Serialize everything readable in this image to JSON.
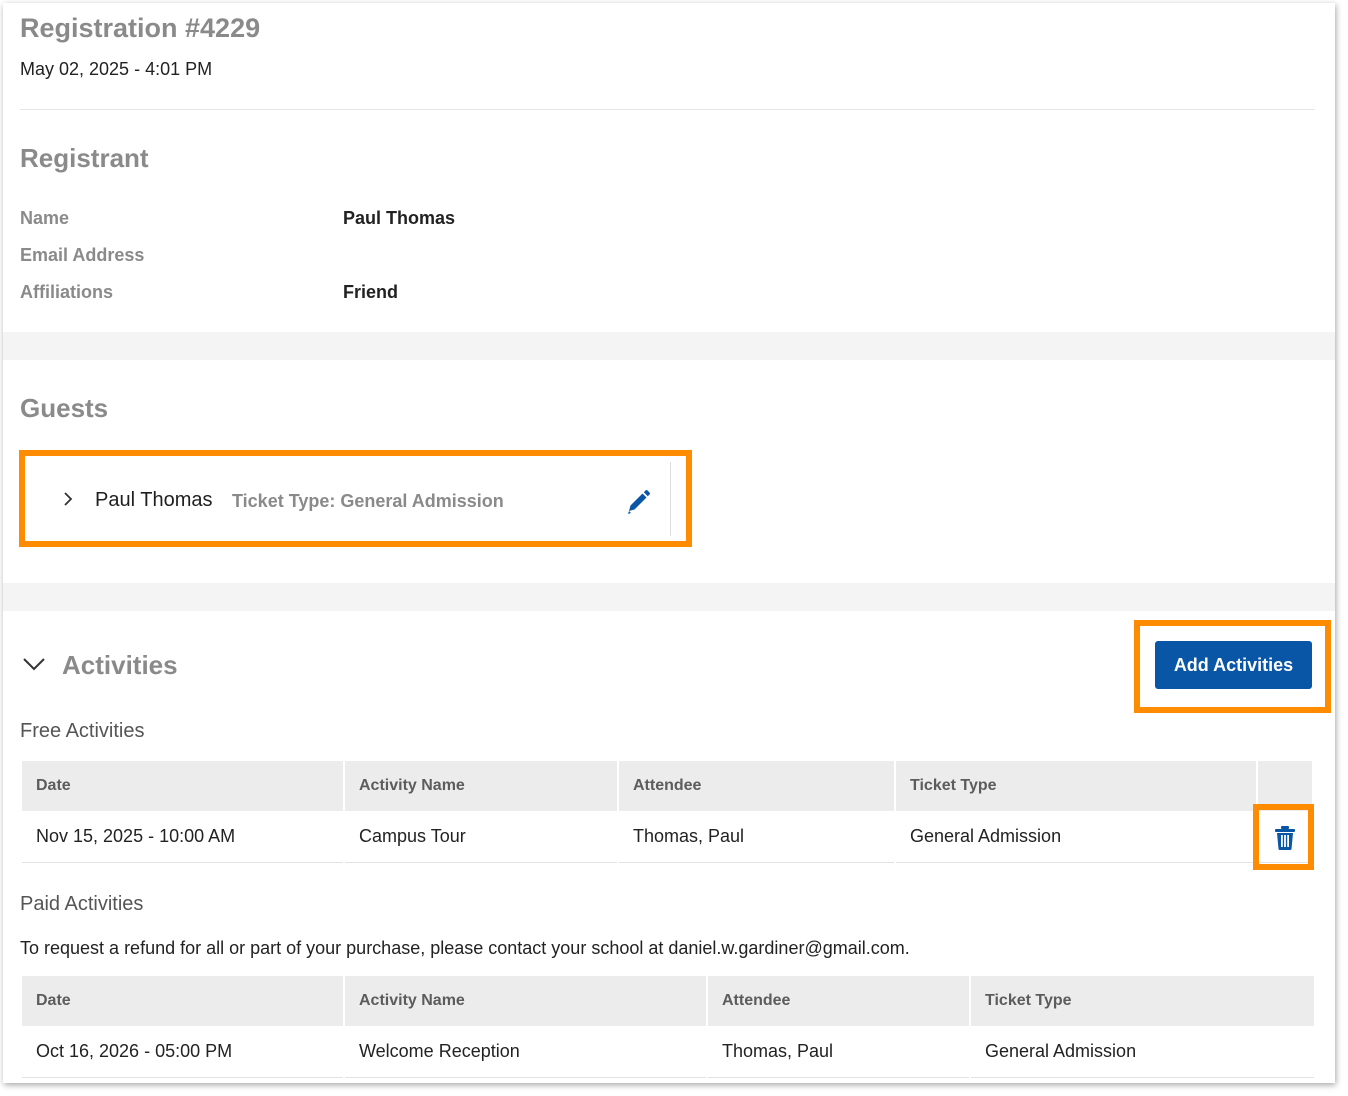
{
  "registration": {
    "title": "Registration #4229",
    "datetime": "May 02, 2025 - 4:01 PM"
  },
  "registrant": {
    "heading": "Registrant",
    "fields": [
      {
        "label": "Name",
        "value": "Paul Thomas"
      },
      {
        "label": "Email Address",
        "value": ""
      },
      {
        "label": "Affiliations",
        "value": "Friend"
      }
    ]
  },
  "guests": {
    "heading": "Guests",
    "items": [
      {
        "name": "Paul Thomas",
        "ticket_type": "Ticket Type: General Admission",
        "icon": "pencil-icon"
      }
    ]
  },
  "activities": {
    "heading": "Activities",
    "add_button": "Add Activities",
    "accent_color": "#0a56a6",
    "highlight_color": "#ff8c00",
    "free": {
      "heading": "Free Activities",
      "columns": [
        "Date",
        "Activity Name",
        "Attendee",
        "Ticket Type"
      ],
      "rows": [
        {
          "date": "Nov 15, 2025 - 10:00 AM",
          "activity": "Campus Tour",
          "attendee": "Thomas, Paul",
          "ticket_type": "General Admission",
          "icon": "trash-icon"
        }
      ]
    },
    "paid": {
      "heading": "Paid Activities",
      "note": "To request a refund for all or part of your purchase, please contact your school at daniel.w.gardiner@gmail.com.",
      "columns": [
        "Date",
        "Activity Name",
        "Attendee",
        "Ticket Type"
      ],
      "rows": [
        {
          "date": "Oct 16, 2026 - 05:00 PM",
          "activity": "Welcome Reception",
          "attendee": "Thomas, Paul",
          "ticket_type": "General Admission"
        }
      ]
    }
  }
}
